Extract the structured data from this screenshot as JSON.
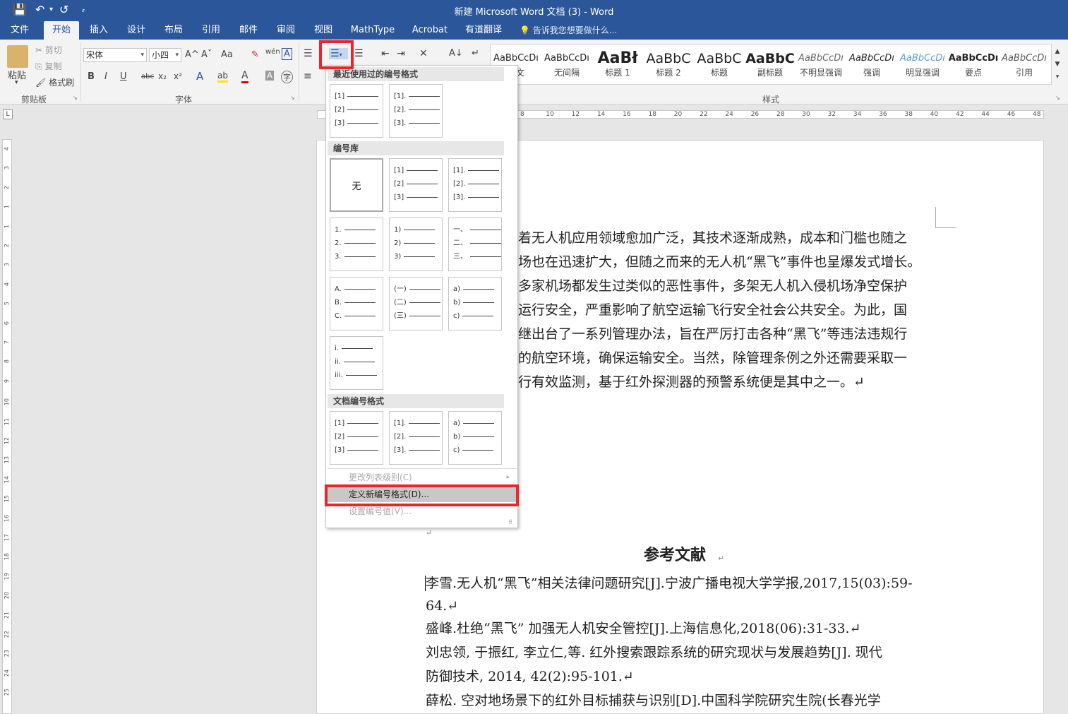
{
  "window": {
    "title": "新建 Microsoft Word 文档 (3) - Word",
    "qat": {
      "save": "💾",
      "undo": "↶",
      "undo_arrow": "▾",
      "redo": "↺",
      "more": "⸗"
    }
  },
  "tabs": [
    "文件",
    "开始",
    "插入",
    "设计",
    "布局",
    "引用",
    "邮件",
    "审阅",
    "视图",
    "MathType",
    "Acrobat",
    "有道翻译"
  ],
  "tell_me": "告诉我您想要做什么...",
  "clipboard": {
    "paste": "粘贴",
    "cut": "剪切",
    "copy": "复制",
    "format_painter": "格式刷",
    "label": "剪贴板"
  },
  "font": {
    "name": "宋体",
    "size": "小四",
    "label": "字体",
    "grow": "A^",
    "shrink": "Aˇ",
    "case": "Aa",
    "clear": "✎",
    "phonetic": "wén",
    "border_char": "A",
    "bold": "B",
    "italic": "I",
    "underline": "U",
    "strike": "abc",
    "sub": "x₂",
    "sup": "x²",
    "effects": "A",
    "highlight": "ab",
    "color": "A",
    "shade": "A",
    "enclose": "字"
  },
  "paragraph": {
    "bullets": "☰",
    "numbering": "☰",
    "multilevel": "☰",
    "decrease": "⇤",
    "increase": "⇥",
    "sort_cn": "✕",
    "sort": "A↓",
    "marks": "↵",
    "align": "≡"
  },
  "styles": {
    "label": "样式",
    "items": [
      {
        "sample": "AaBbCcDı",
        "name": "正文"
      },
      {
        "sample": "AaBbCcDı",
        "name": "无间隔"
      },
      {
        "sample": "AaBł",
        "name": "标题 1"
      },
      {
        "sample": "AaBbC",
        "name": "标题 2"
      },
      {
        "sample": "AaBbC",
        "name": "标题"
      },
      {
        "sample": "AaBbC",
        "name": "副标题"
      },
      {
        "sample": "AaBbCcDı",
        "name": "不明显强调"
      },
      {
        "sample": "AaBbCcDı",
        "name": "强调"
      },
      {
        "sample": "AaBbCcDı",
        "name": "明显强调"
      },
      {
        "sample": "AaBbCcDı",
        "name": "要点"
      },
      {
        "sample": "AaBbCcDı",
        "name": "引用"
      }
    ]
  },
  "ruler": {
    "ticks": [
      "8",
      "10",
      "12",
      "14",
      "16",
      "18",
      "20",
      "22",
      "24",
      "26",
      "28",
      "30",
      "32",
      "34",
      "36",
      "38",
      "40",
      "42",
      "44",
      "46",
      "48"
    ],
    "v_ticks": [
      "4",
      "3",
      "2",
      "1",
      "1",
      "2",
      "3",
      "4",
      "5",
      "6",
      "7",
      "8",
      "9",
      "10",
      "11",
      "12",
      "13",
      "14",
      "15",
      "16",
      "17",
      "18",
      "19",
      "20",
      "21",
      "22",
      "23",
      "24",
      "25"
    ]
  },
  "numbering_menu": {
    "recent_header": "最近使用过的编号格式",
    "library_header": "编号库",
    "doc_header": "文档编号格式",
    "none_label": "无",
    "recent": [
      [
        "[1]",
        "[2]",
        "[3]"
      ],
      [
        "[1].",
        "[2].",
        "[3]."
      ]
    ],
    "library": [
      [
        "[1]",
        "[2]",
        "[3]"
      ],
      [
        "[1].",
        "[2].",
        "[3]."
      ],
      [
        "1.",
        "2.",
        "3."
      ],
      [
        "1)",
        "2)",
        "3)"
      ],
      [
        "一、",
        "二、",
        "三、"
      ],
      [
        "A.",
        "B.",
        "C."
      ],
      [
        "(一)",
        "(二)",
        "(三)"
      ],
      [
        "a)",
        "b)",
        "c)"
      ],
      [
        "i.",
        "ii.",
        "iii."
      ]
    ],
    "doc": [
      [
        "[1]",
        "[2]",
        "[3]"
      ],
      [
        "[1].",
        "[2].",
        "[3]."
      ],
      [
        "a)",
        "b)",
        "c)"
      ]
    ],
    "change_level": "更改列表级别(C)",
    "define_new": "定义新编号格式(D)...",
    "set_value": "设置编号值(V)..."
  },
  "document": {
    "lines": [
      "着无人机应用领域愈加广泛，其技术逐渐成熟，成本和门槛也随之",
      "场也在迅速扩大，但随之而来的无人机“黑飞”事件也呈爆发式增长。",
      "多家机场都发生过类似的恶性事件，多架无人机入侵机场净空保护",
      "运行安全，严重影响了航空运输飞行安全社会公共安全。为此，国",
      "继出台了一系列管理办法，旨在严厉打击各种“黑飞”等违法违规行",
      "的航空环境，确保运输安全。当然，除管理条例之外还需要采取一",
      "行有效监测，基于红外探测器的预警系统便是其中之一。↵"
    ],
    "ref_title": "参考文献",
    "refs": [
      "李雪.无人机“黑飞”相关法律问题研究[J].宁波广播电视大学学报,2017,15(03):59-",
      "64.↵",
      "盛峰.杜绝“黑飞” 加强无人机安全管控[J].上海信息化,2018(06):31-33.↵",
      "刘忠领, 于振红, 李立仁,等. 红外搜索跟踪系统的研究现状与发展趋势[J]. 现代",
      "防御技术, 2014, 42(2):95-101.↵",
      "薛松. 空对地场景下的红外目标捕获与识别[D].中国科学院研究生院(长春光学"
    ],
    "para_mark": "↵"
  },
  "colors": {
    "accent": "#2b579a",
    "highlight": "#e8262d"
  }
}
